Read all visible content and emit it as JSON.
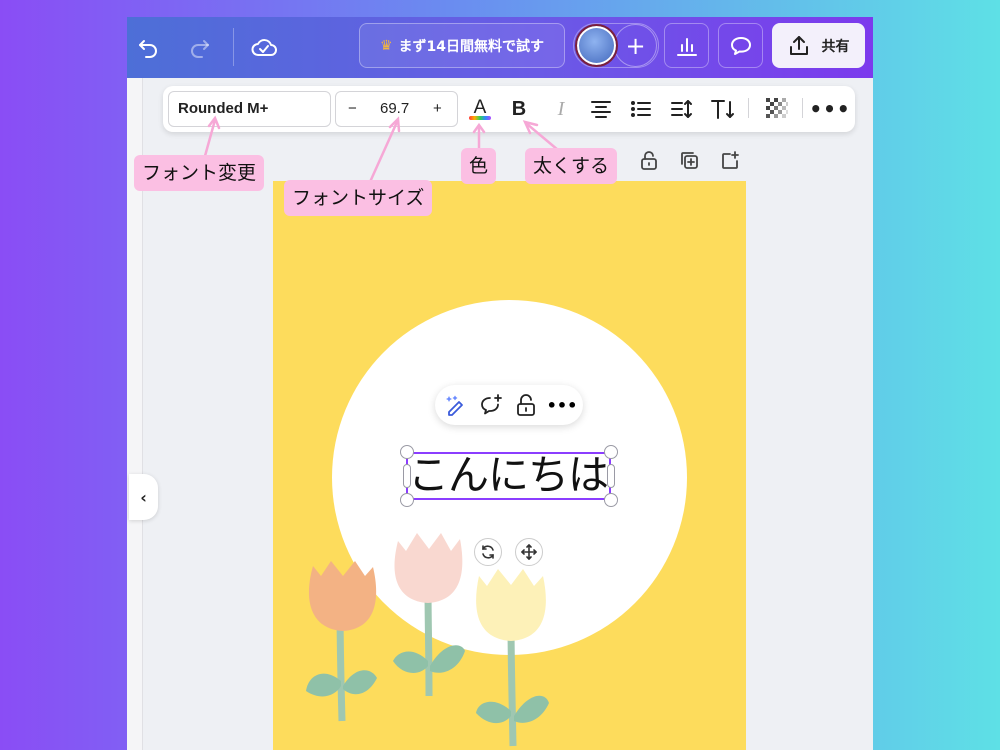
{
  "topbar": {
    "trial_label": "まず14日間無料で試す",
    "share_label": "共有"
  },
  "text_toolbar": {
    "font_name": "Rounded M+",
    "font_size": "69.7",
    "decrease_label": "−",
    "increase_label": "+"
  },
  "canvas": {
    "text_content": "こんにちは",
    "page_color": "#fddc5c"
  },
  "annotations": {
    "font_change": "フォント変更",
    "font_size": "フォントサイズ",
    "color": "色",
    "bold": "太くする"
  },
  "colors": {
    "accent": "#8b3dff",
    "annotation_bg": "#fbbfe3"
  }
}
